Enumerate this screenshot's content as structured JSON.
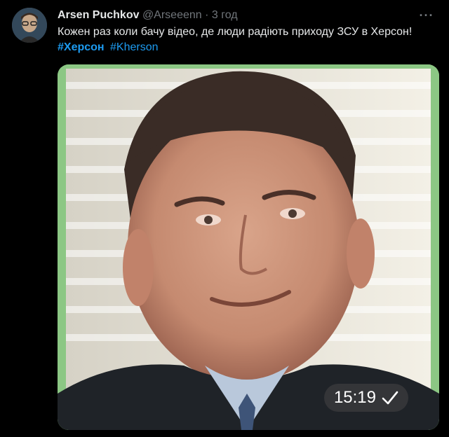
{
  "tweet": {
    "author_name": "Arsen Puchkov",
    "handle": "@Arseeenn",
    "separator": "·",
    "time": "3 год",
    "text": "Кожен раз коли бачу відео, де люди радіють приходу ЗСУ в Херсон!",
    "hashtags": [
      "#Херсон",
      "#Kherson"
    ],
    "more_icon": "more-horizontal-icon",
    "link_color": "#1d9bf0"
  },
  "media": {
    "timestamp": "15:19",
    "status_icon": "checkmark-icon",
    "frame_color": "#8cc784"
  }
}
